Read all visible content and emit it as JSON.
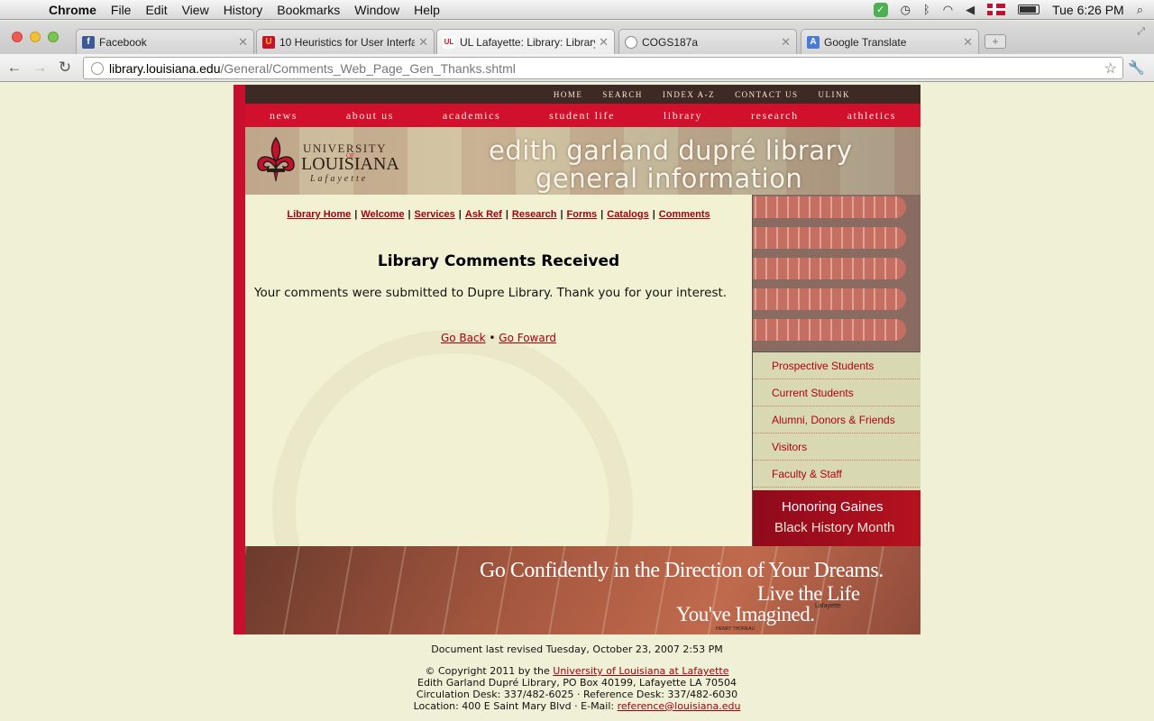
{
  "menubar": {
    "app": "Chrome",
    "menus": [
      "File",
      "Edit",
      "View",
      "History",
      "Bookmarks",
      "Window",
      "Help"
    ],
    "clock": "Tue 6:26 PM"
  },
  "tabs": [
    {
      "title": "Facebook",
      "favicon_color": "#3b5998",
      "favicon_glyph": "f"
    },
    {
      "title": "10 Heuristics for User Interfa",
      "favicon_color": "#c8102e",
      "favicon_glyph": "U"
    },
    {
      "title": "UL Lafayette: Library: Library",
      "favicon_color": "#ffffff",
      "favicon_glyph": "UL"
    },
    {
      "title": "COGS187a",
      "favicon_color": "#8a8a8a",
      "favicon_glyph": ""
    },
    {
      "title": "Google Translate",
      "favicon_color": "#4a7bd4",
      "favicon_glyph": "A"
    }
  ],
  "address": {
    "host": "library.louisiana.edu",
    "path": "/General/Comments_Web_Page_Gen_Thanks.shtml"
  },
  "site": {
    "util_links": [
      "HOME",
      "SEARCH",
      "INDEX A-Z",
      "CONTACT US",
      "ULINK"
    ],
    "main_nav": [
      "news",
      "about us",
      "academics",
      "student life",
      "library",
      "research",
      "athletics"
    ],
    "logo": {
      "line1": "UNIVERSITY",
      "of": "OF",
      "line2": "LOUISIANA",
      "line3": "Lafayette"
    },
    "banner_title_1": "edith garland dupré library",
    "banner_title_2": "general information",
    "sublinks": [
      "Library Home",
      "Welcome",
      "Services",
      "Ask Ref",
      "Research",
      "Forms",
      "Catalogs",
      "Comments"
    ],
    "heading": "Library Comments Received",
    "message": "Your comments were submitted to Dupre Library. Thank you for your interest.",
    "go_back": "Go Back",
    "go_forward": "Go Foward",
    "bullet": "•",
    "side_menu": [
      "Prospective Students",
      "Current Students",
      "Alumni, Donors & Friends",
      "Visitors",
      "Faculty & Staff"
    ],
    "honor_line1": "Honoring Gaines",
    "honor_line2": "Black History Month",
    "footer_banner": {
      "line1": "Go Confidently in the Direction of Your Dreams.",
      "line2": "Live the Life",
      "line3": "You've Imagined.",
      "small": "Lafayette",
      "credit": "HENRY THOREAU"
    }
  },
  "footer": {
    "revised": "Document last revised Tuesday, October 23, 2007 2:53 PM",
    "copyright_prefix": "© Copyright 2011 by the ",
    "copyright_link": "University of Louisiana at Lafayette",
    "address": "Edith Garland Dupré Library, PO Box 40199, Lafayette LA 70504",
    "desks": "Circulation Desk: 337/482-6025 · Reference Desk: 337/482-6030",
    "location_prefix": "Location: 400 E Saint Mary Blvd · E-Mail: ",
    "email": "reference@louisiana.edu"
  },
  "colors": {
    "brand_red": "#c8102e",
    "page_bg": "#f0f0d6",
    "link": "#a3000f"
  }
}
